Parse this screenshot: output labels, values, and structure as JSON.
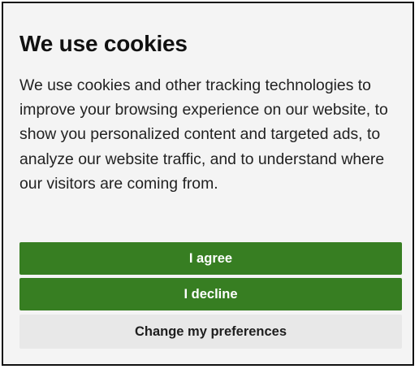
{
  "dialog": {
    "title": "We use cookies",
    "body": "We use cookies and other tracking technologies to improve your browsing experience on our website, to show you personalized content and targeted ads, to analyze our website traffic, and to understand where our visitors are coming from.",
    "buttons": {
      "agree": "I agree",
      "decline": "I decline",
      "preferences": "Change my preferences"
    },
    "colors": {
      "primary_button": "#377e22",
      "secondary_button": "#e8e8e8",
      "background": "#f4f4f4"
    }
  }
}
